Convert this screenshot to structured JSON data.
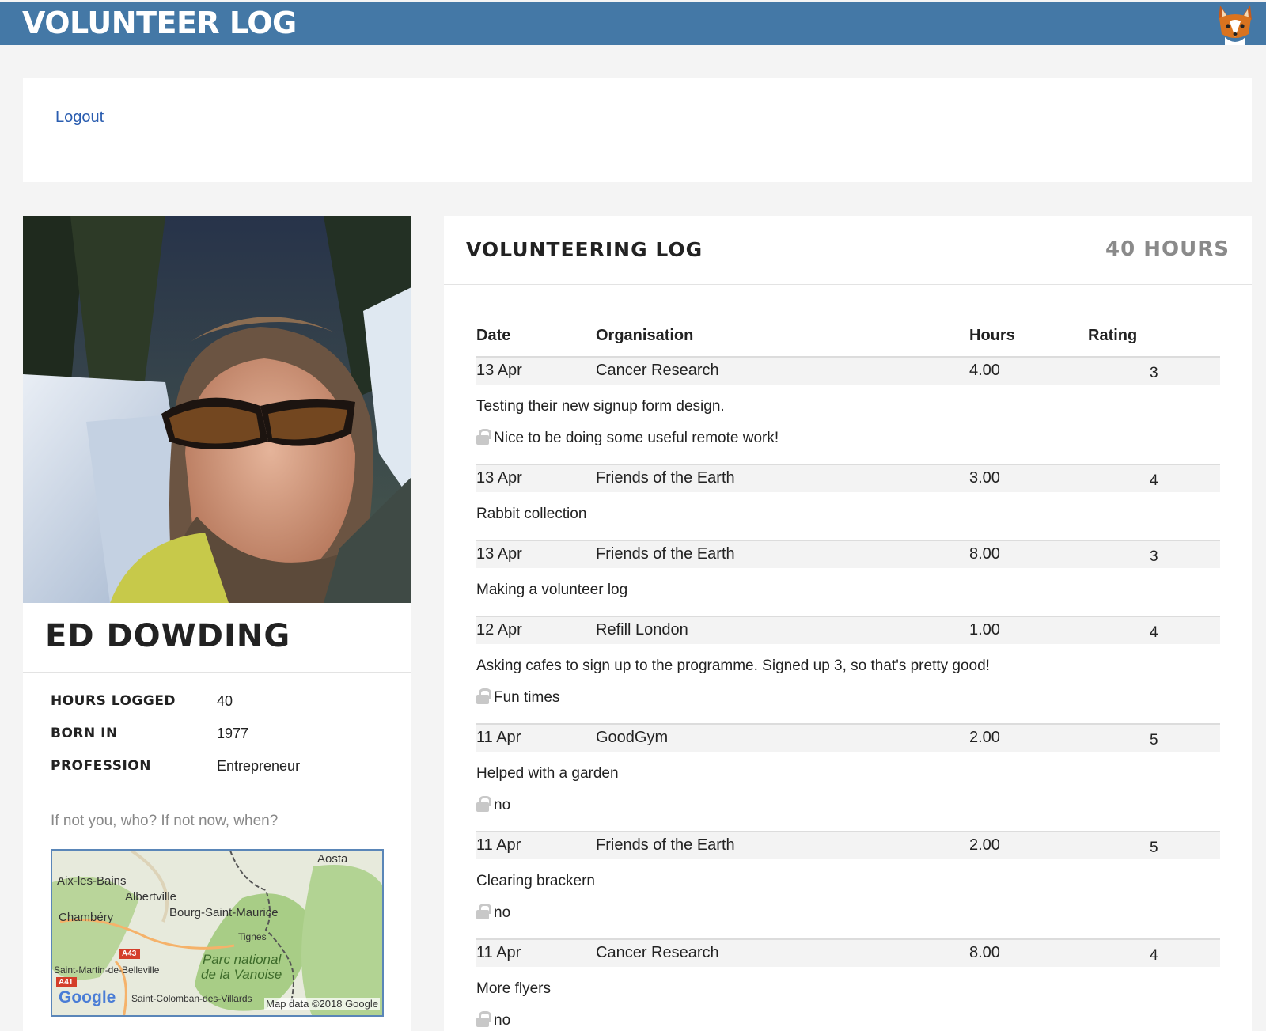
{
  "header": {
    "title": "VOLUNTEER LOG",
    "mascot_icon": "fox-icon",
    "color": "#4478a6"
  },
  "nav": {
    "logout_label": "Logout"
  },
  "profile": {
    "photo_icon": "profile-photo",
    "name": "ED DOWDING",
    "stats": [
      {
        "label": "HOURS LOGGED",
        "value": "40"
      },
      {
        "label": "BORN IN",
        "value": "1977"
      },
      {
        "label": "PROFESSION",
        "value": "Entrepreneur"
      }
    ],
    "motto": "If not you, who? If not now, when?",
    "map": {
      "places": [
        "Aosta",
        "Aix-les-Bains",
        "Albertville",
        "Chambéry",
        "Bourg-Saint-Maurice",
        "Tignes",
        "Parc national",
        "de la Vanoise",
        "Saint-Martin-de-Belleville",
        "Saint-Colomban-des-Villards",
        "A43",
        "A41"
      ],
      "logo": "Google",
      "attribution": "Map data ©2018 Google"
    }
  },
  "log": {
    "title": "VOLUNTEERING LOG",
    "total": "40 HOURS",
    "columns": {
      "date": "Date",
      "organisation": "Organisation",
      "hours": "Hours",
      "rating": "Rating"
    },
    "entries": [
      {
        "date": "13 Apr",
        "organisation": "Cancer Research",
        "hours": "4.00",
        "rating": "3",
        "description": "Testing their new signup form design.",
        "note": "Nice to be doing some useful remote work!"
      },
      {
        "date": "13 Apr",
        "organisation": "Friends of the Earth",
        "hours": "3.00",
        "rating": "4",
        "description": "Rabbit collection",
        "note": ""
      },
      {
        "date": "13 Apr",
        "organisation": "Friends of the Earth",
        "hours": "8.00",
        "rating": "3",
        "description": "Making a volunteer log",
        "note": ""
      },
      {
        "date": "12 Apr",
        "organisation": "Refill London",
        "hours": "1.00",
        "rating": "4",
        "description": "Asking cafes to sign up to the programme. Signed up 3, so that's pretty good!",
        "note": "Fun times"
      },
      {
        "date": "11 Apr",
        "organisation": "GoodGym",
        "hours": "2.00",
        "rating": "5",
        "description": "Helped with a garden",
        "note": "no"
      },
      {
        "date": "11 Apr",
        "organisation": "Friends of the Earth",
        "hours": "2.00",
        "rating": "5",
        "description": "Clearing brackern",
        "note": "no"
      },
      {
        "date": "11 Apr",
        "organisation": "Cancer Research",
        "hours": "8.00",
        "rating": "4",
        "description": "More flyers",
        "note": "no"
      }
    ]
  }
}
